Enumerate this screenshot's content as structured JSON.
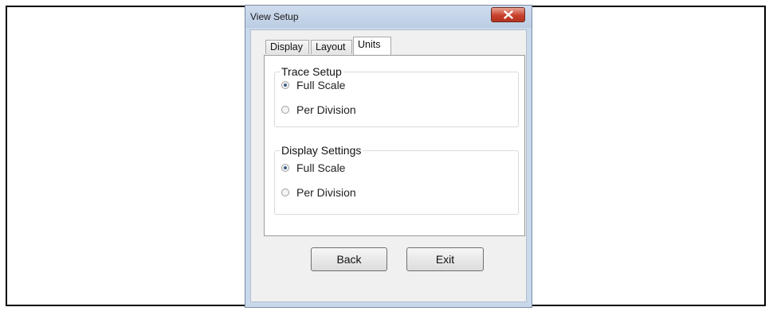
{
  "window": {
    "title": "View Setup",
    "close_icon": "close-icon",
    "close_color": "#c8412c"
  },
  "tabs": [
    {
      "label": "Display",
      "active": false
    },
    {
      "label": "Layout",
      "active": false
    },
    {
      "label": "Units",
      "active": true
    }
  ],
  "groups": [
    {
      "legend": "Trace Setup",
      "options": [
        {
          "label": "Full Scale",
          "selected": true
        },
        {
          "label": "Per Division",
          "selected": false
        }
      ]
    },
    {
      "legend": "Display Settings",
      "options": [
        {
          "label": "Full Scale",
          "selected": true
        },
        {
          "label": "Per Division",
          "selected": false
        }
      ]
    }
  ],
  "buttons": {
    "back_label": "Back",
    "exit_label": "Exit"
  }
}
